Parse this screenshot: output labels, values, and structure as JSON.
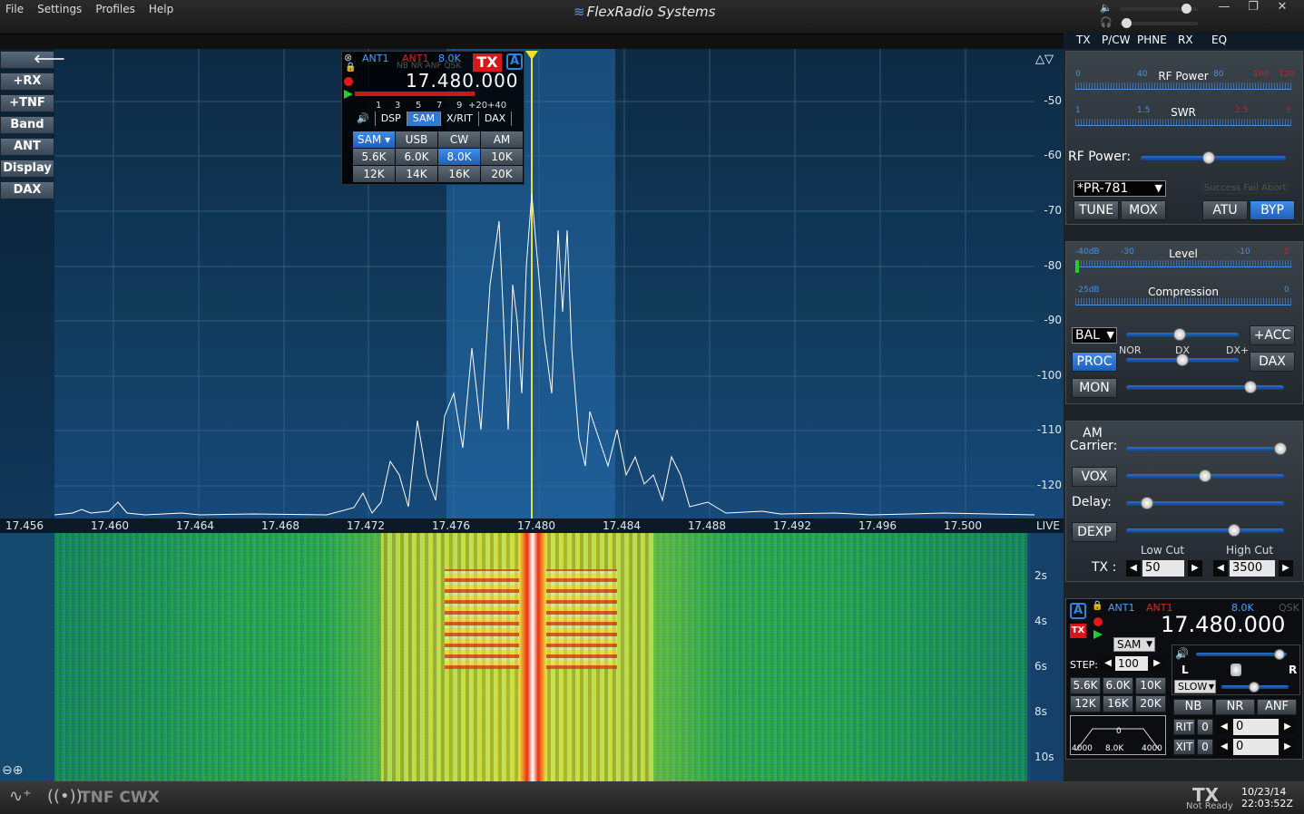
{
  "menu": {
    "file": "File",
    "settings": "Settings",
    "profiles": "Profiles",
    "help": "Help"
  },
  "brand": "FlexRadio Systems",
  "window_controls": {
    "minimize": "—",
    "maximize": "❐",
    "close": "✕"
  },
  "left_tools": [
    "+RX",
    "+TNF",
    "Band",
    "ANT",
    "Display",
    "DAX"
  ],
  "panadapter": {
    "dbm_ticks": [
      "-50",
      "-60",
      "-70",
      "-80",
      "-90",
      "-100",
      "-110",
      "-120"
    ],
    "freq_ticks": [
      "17.456",
      "17.460",
      "17.464",
      "17.468",
      "17.472",
      "17.476",
      "17.480",
      "17.484",
      "17.488",
      "17.492",
      "17.496",
      "17.500"
    ],
    "live": "LIVE"
  },
  "waterfall": {
    "time_ticks": [
      "2s",
      "4s",
      "6s",
      "8s",
      "10s"
    ]
  },
  "slice_flag": {
    "ant_rx": "ANT1",
    "ant_tx": "ANT1",
    "bandwidth": "8.0K",
    "dsp_flags": "NB NR ANF QSK",
    "tx": "TX",
    "letter": "A",
    "frequency": "17.480.000",
    "smeter_ticks": [
      "1",
      "3",
      "5",
      "7",
      "9",
      "+20",
      "+40"
    ],
    "tabs": [
      "DSP",
      "SAM",
      "X/RIT",
      "DAX"
    ],
    "selected_tab": "SAM",
    "modes": [
      "SAM ▾",
      "USB",
      "CW",
      "AM",
      "5.6K",
      "6.0K",
      "8.0K",
      "10K",
      "12K",
      "14K",
      "16K",
      "20K"
    ]
  },
  "right_tabs": [
    "TX",
    "P/CW",
    "PHNE",
    "RX",
    "EQ"
  ],
  "tx_panel": {
    "rf_meter": {
      "label": "RF Power",
      "scale": [
        "0",
        "40",
        "80",
        "100",
        "120"
      ]
    },
    "swr_meter": {
      "label": "SWR",
      "scale": [
        "1",
        "1.5",
        "2.5",
        "3"
      ]
    },
    "rf_power_label": "RF Power:",
    "rf_power_level": 0.47,
    "profile": "*PR-781",
    "atu_status": "Success Fail Abort",
    "buttons": [
      "TUNE",
      "MOX",
      "ATU",
      "BYP"
    ]
  },
  "phone_panel": {
    "level_meter": {
      "label": "Level",
      "scale": [
        "-40dB",
        "-30",
        "-10",
        "0"
      ]
    },
    "compression_meter": {
      "label": "Compression",
      "scale": [
        "-25dB",
        "0"
      ]
    },
    "bal": "BAL",
    "acc": "+ACC",
    "proc": "PROC",
    "proc_scale": [
      "NOR",
      "DX",
      "DX+"
    ],
    "dax": "DAX",
    "mon": "MON"
  },
  "am_panel": {
    "am_carrier": "AM Carrier:",
    "vox": "VOX",
    "delay": "Delay:",
    "dexp": "DEXP",
    "low_cut_label": "Low Cut",
    "high_cut_label": "High Cut",
    "tx_label": "TX :",
    "low_cut": "50",
    "high_cut": "3500"
  },
  "slice_panel": {
    "letter": "A",
    "ant_rx": "ANT1",
    "ant_tx": "ANT1",
    "bandwidth": "8.0K",
    "qsk": "QSK",
    "tx": "TX",
    "frequency": "17.480.000",
    "mode": "SAM",
    "step_label": "STEP:",
    "step": "100",
    "filters": [
      "5.6K",
      "6.0K",
      "10K",
      "12K",
      "16K",
      "20K"
    ],
    "lr": {
      "l": "L",
      "r": "R"
    },
    "agc": "SLOW",
    "dsp": [
      "NB",
      "NR",
      "ANF"
    ],
    "rit_label": "RIT",
    "rit_on": "0",
    "rit_value": "0",
    "xit_label": "XIT",
    "xit_on": "0",
    "xit_value": "0",
    "filter_graph": {
      "left": "4000",
      "center": "8.0K",
      "right": "4000",
      "mid": "0"
    }
  },
  "status": {
    "tnf_cwx": "TNF CWX",
    "tx": "TX",
    "tx_state": "Not Ready",
    "date": "10/23/14",
    "time": "22:03:52Z"
  }
}
